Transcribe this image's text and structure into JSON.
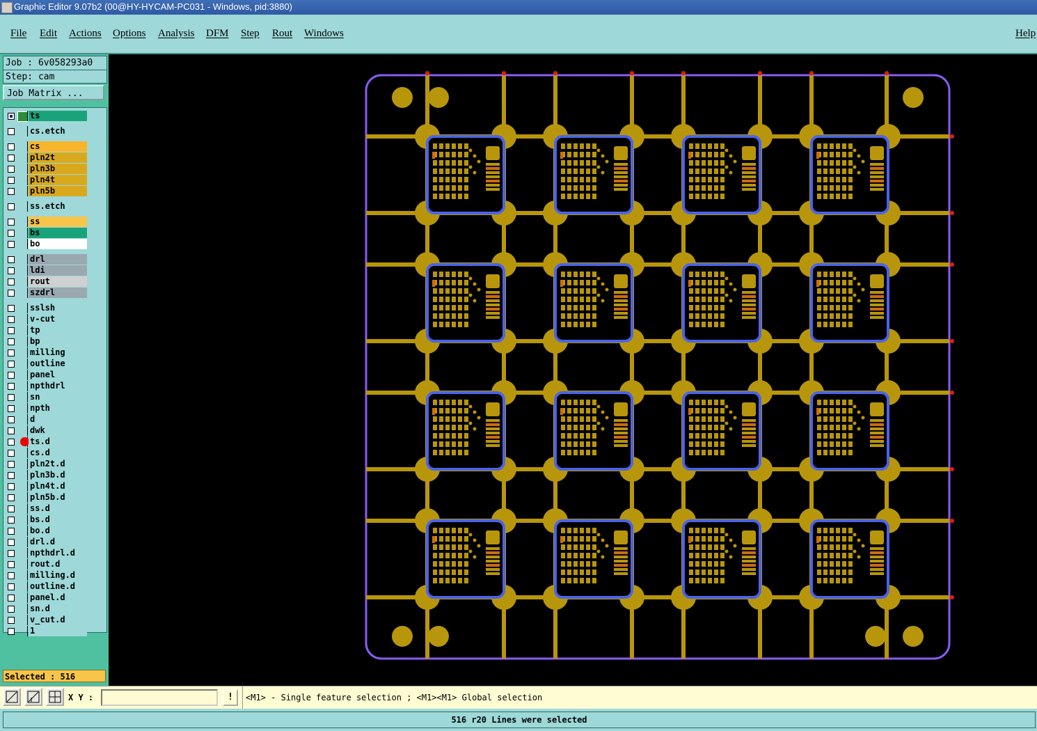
{
  "window": {
    "title": "Graphic Editor 9.07b2 (00@HY-HYCAM-PC031 - Windows, pid:3880)"
  },
  "menu": [
    "File",
    "Edit",
    "Actions",
    "Options",
    "Analysis",
    "DFM",
    "Step",
    "Rout",
    "Windows",
    "Help"
  ],
  "job": {
    "job_line": "Job : 6v058293a0",
    "step_line": "Step: cam",
    "matrix_button": "Job Matrix ..."
  },
  "layers": [
    {
      "name": "ts",
      "color": "#1aa37a"
    },
    {
      "name": "cs.etch",
      "color": "#9ed8d8"
    },
    {
      "name": "cs",
      "color": "#f7b52c"
    },
    {
      "name": "pln2t",
      "color": "#d9a91d"
    },
    {
      "name": "pln3b",
      "color": "#d9a91d"
    },
    {
      "name": "pln4t",
      "color": "#d9a91d"
    },
    {
      "name": "pln5b",
      "color": "#d9a91d"
    },
    {
      "name": "ss.etch",
      "color": "#9ed8d8"
    },
    {
      "name": "ss",
      "color": "#f7c54a"
    },
    {
      "name": "bs",
      "color": "#1aa37a"
    },
    {
      "name": "bo",
      "color": "#ffffff"
    },
    {
      "name": "drl",
      "color": "#9aa8b0"
    },
    {
      "name": "ldi",
      "color": "#9aa8b0"
    },
    {
      "name": "rout",
      "color": "#d0d0d0"
    },
    {
      "name": "szdrl",
      "color": "#9aa8b0"
    },
    {
      "name": "sslsh",
      "color": "#9ed8d8"
    },
    {
      "name": "v-cut",
      "color": "#9ed8d8"
    },
    {
      "name": "tp",
      "color": "#9ed8d8"
    },
    {
      "name": "bp",
      "color": "#9ed8d8"
    },
    {
      "name": "milling",
      "color": "#9ed8d8"
    },
    {
      "name": "outline",
      "color": "#9ed8d8"
    },
    {
      "name": "panel",
      "color": "#9ed8d8"
    },
    {
      "name": "npthdrl",
      "color": "#9ed8d8"
    },
    {
      "name": "sn",
      "color": "#9ed8d8"
    },
    {
      "name": "npth",
      "color": "#9ed8d8"
    },
    {
      "name": "d",
      "color": "#9ed8d8"
    },
    {
      "name": "dwk",
      "color": "#9ed8d8"
    },
    {
      "name": "ts.d",
      "color": "#9ed8d8",
      "marker": true
    },
    {
      "name": "cs.d",
      "color": "#9ed8d8"
    },
    {
      "name": "pln2t.d",
      "color": "#9ed8d8"
    },
    {
      "name": "pln3b.d",
      "color": "#9ed8d8"
    },
    {
      "name": "pln4t.d",
      "color": "#9ed8d8"
    },
    {
      "name": "pln5b.d",
      "color": "#9ed8d8"
    },
    {
      "name": "ss.d",
      "color": "#9ed8d8"
    },
    {
      "name": "bs.d",
      "color": "#9ed8d8"
    },
    {
      "name": "bo.d",
      "color": "#9ed8d8"
    },
    {
      "name": "drl.d",
      "color": "#9ed8d8"
    },
    {
      "name": "npthdrl.d",
      "color": "#9ed8d8"
    },
    {
      "name": "rout.d",
      "color": "#9ed8d8"
    },
    {
      "name": "milling.d",
      "color": "#9ed8d8"
    },
    {
      "name": "outline.d",
      "color": "#9ed8d8"
    },
    {
      "name": "panel.d",
      "color": "#9ed8d8"
    },
    {
      "name": "sn.d",
      "color": "#9ed8d8"
    },
    {
      "name": "v_cut.d",
      "color": "#9ed8d8"
    },
    {
      "name": "1",
      "color": "#9ed8d8"
    }
  ],
  "selected": "Selected : 516",
  "statusbar": {
    "xy_label": "X Y :",
    "xy_value": "",
    "bang": "!",
    "hint": "<M1> - Single feature selection ; <M1><M1> Global selection",
    "message": "516 r20 Lines were selected"
  },
  "colors": {
    "board_copper": "#b8960b",
    "outline": "#8a5cf5",
    "pcb_frame": "#4a63e8",
    "pad_red": "#e31b1b"
  }
}
